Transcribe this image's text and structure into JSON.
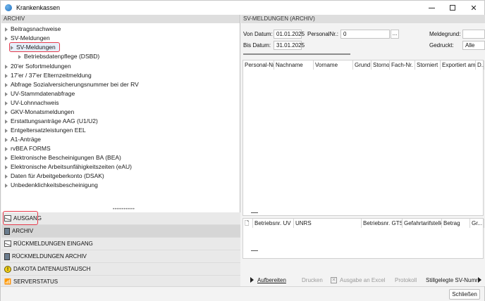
{
  "window": {
    "title": "Krankenkassen"
  },
  "left": {
    "header": "ARCHIV",
    "tree": [
      {
        "label": "Beitragsnachweise"
      },
      {
        "label": "SV-Meldungen"
      },
      {
        "label": "SV-Meldungen"
      },
      {
        "label": "Betriebsdatenpflege (DSBD)"
      },
      {
        "label": "20'er Sofortmeldungen"
      },
      {
        "label": "17'er / 37'er Elternzeitmeldung"
      },
      {
        "label": "Abfrage Sozialversicherungsnummer bei der RV"
      },
      {
        "label": "UV-Stammdatenabfrage"
      },
      {
        "label": "UV-Lohnnachweis"
      },
      {
        "label": "GKV-Monatsmeldungen"
      },
      {
        "label": "Erstattungsanträge AAG (U1/U2)"
      },
      {
        "label": "Entgeltersatzleistungen EEL"
      },
      {
        "label": "A1-Anträge"
      },
      {
        "label": "rvBEA FORMS"
      },
      {
        "label": "Elektronische Bescheinigungen BA (BEA)"
      },
      {
        "label": "Elektronische Arbeitsunfähigkeitszeiten (eAU)"
      },
      {
        "label": "Daten für Arbeitgeberkonto (DSAK)"
      },
      {
        "label": "Unbedenklichkeitsbescheinigung"
      }
    ],
    "nav": [
      {
        "label": "AUSGANG",
        "icon": "envelope-icon"
      },
      {
        "label": "ARCHIV",
        "icon": "archive-icon"
      },
      {
        "label": "RÜCKMELDUNGEN EINGANG",
        "icon": "envelope-icon"
      },
      {
        "label": "RÜCKMELDUNGEN ARCHIV",
        "icon": "archive-icon"
      },
      {
        "label": "DAKOTA DATENAUSTAUSCH",
        "icon": "warning-icon"
      },
      {
        "label": "SERVERSTATUS",
        "icon": "chart-icon"
      }
    ]
  },
  "right": {
    "header": "SV-MELDUNGEN (ARCHIV)",
    "filters": {
      "von_datum_label": "Von Datum:",
      "von_datum_value": "01.01.2025",
      "bis_datum_label": "Bis Datum:",
      "bis_datum_value": "31.01.2025",
      "personalnr_label": "PersonalNr.:",
      "personalnr_value": "0",
      "ellipsis": "...",
      "meldegrund_label": "Meldegrund:",
      "meldegrund_value": "",
      "gedruckt_label": "Gedruckt:",
      "gedruckt_value": "Alle"
    },
    "table1_columns": [
      "Personal-Nr.",
      "Nachname",
      "Vorname",
      "Grund",
      "Storno",
      "Fach-Nr.",
      "Storniert",
      "Exportiert am",
      "D..."
    ],
    "table2_columns": [
      "",
      "Betriebsnr. UV",
      "UNRS",
      "Betriebsnr. GTS",
      "Gefahrtarifstelle",
      "Betrag",
      "Gr..."
    ],
    "actions": {
      "aufbereiten": "Aufbereiten",
      "drucken": "Drucken",
      "ausgabe_excel": "Ausgabe an Excel",
      "protokoll": "Protokoll",
      "stillgelegte": "Stillgelegte SV-Numr"
    }
  },
  "footer": {
    "close_label": "Schließen"
  }
}
